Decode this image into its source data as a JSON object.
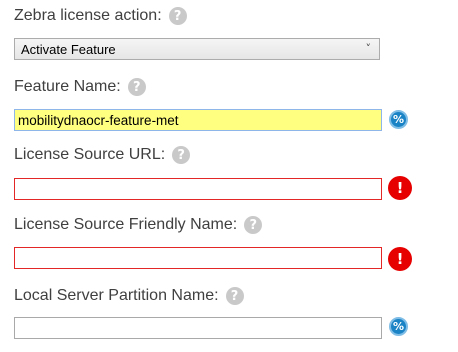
{
  "zebra_action": {
    "label": "Zebra license action:",
    "help_glyph": "?",
    "selected": "Activate Feature",
    "chevron": "˅"
  },
  "feature_name": {
    "label": "Feature Name:",
    "help_glyph": "?",
    "value": "mobilitydnaocr-feature-met",
    "side_icon": "variable-icon",
    "side_glyph": "%"
  },
  "license_source_url": {
    "label": "License Source URL:",
    "help_glyph": "?",
    "value": "",
    "side_icon": "error-icon",
    "side_glyph": "!"
  },
  "license_source_friendly_name": {
    "label": "License Source Friendly Name:",
    "help_glyph": "?",
    "value": "",
    "side_icon": "error-icon",
    "side_glyph": "!"
  },
  "local_server_partition_name": {
    "label": "Local Server Partition Name:",
    "help_glyph": "?",
    "value": "",
    "side_icon": "variable-icon",
    "side_glyph": "%"
  },
  "colors": {
    "highlight_field": "#ffff80",
    "error_border": "#e32626",
    "error_icon": "#e60000",
    "variable_icon": "#1a83c6",
    "help_icon": "#c9c9c9"
  }
}
